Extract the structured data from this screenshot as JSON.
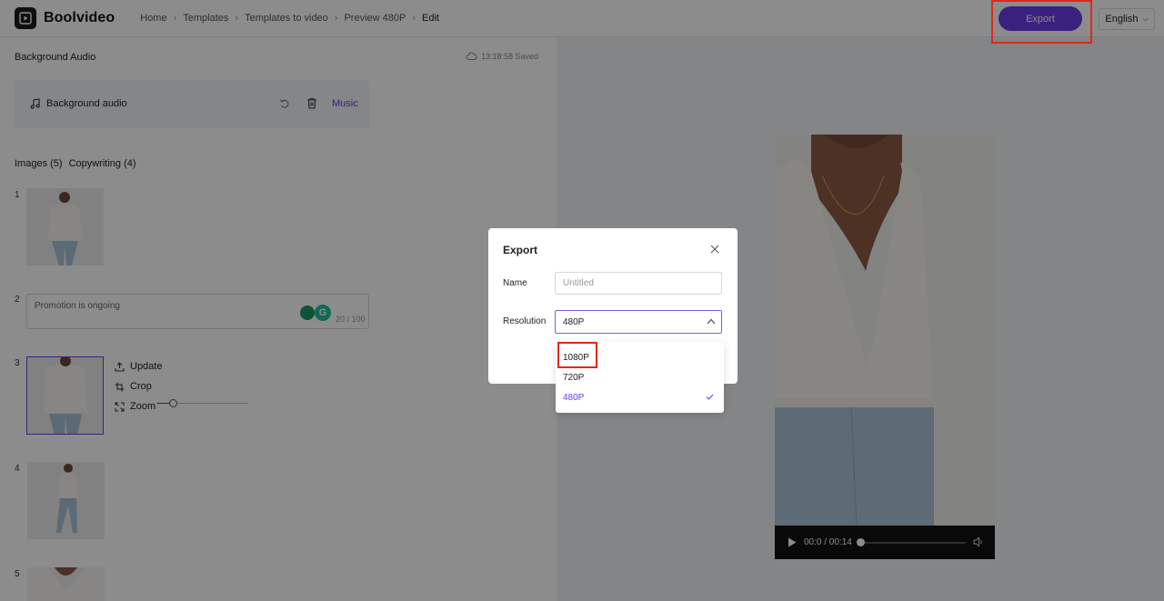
{
  "app": {
    "name": "Boolvideo"
  },
  "breadcrumb": [
    "Home",
    "Templates",
    "Templates to video",
    "Preview 480P",
    "Edit"
  ],
  "header": {
    "export_label": "Export",
    "language": "English"
  },
  "background_audio": {
    "section_title": "Background Audio",
    "saved_status": "13:18:58 Saved",
    "label": "Background audio",
    "music_label": "Music"
  },
  "tabs": [
    "Images (5)",
    "Copywriting (4)"
  ],
  "items": [
    {
      "index": "1"
    },
    {
      "index": "2",
      "text": "Promotion is ongoing",
      "count": "20 / 100"
    },
    {
      "index": "3"
    },
    {
      "index": "4"
    },
    {
      "index": "5"
    }
  ],
  "tools": {
    "update": "Update",
    "crop": "Crop",
    "zoom": "Zoom",
    "zoom_level": 0.17
  },
  "video": {
    "time": "00:0 / 00:14",
    "progress": 0.0
  },
  "modal": {
    "title": "Export",
    "name_label": "Name",
    "name_placeholder": "Untitled",
    "resolution_label": "Resolution",
    "resolution_value": "480P",
    "options": [
      "1080P",
      "720P",
      "480P"
    ],
    "selected_option": "480P"
  },
  "colors": {
    "accent": "#6a3de8",
    "highlight": "#e0261e"
  }
}
